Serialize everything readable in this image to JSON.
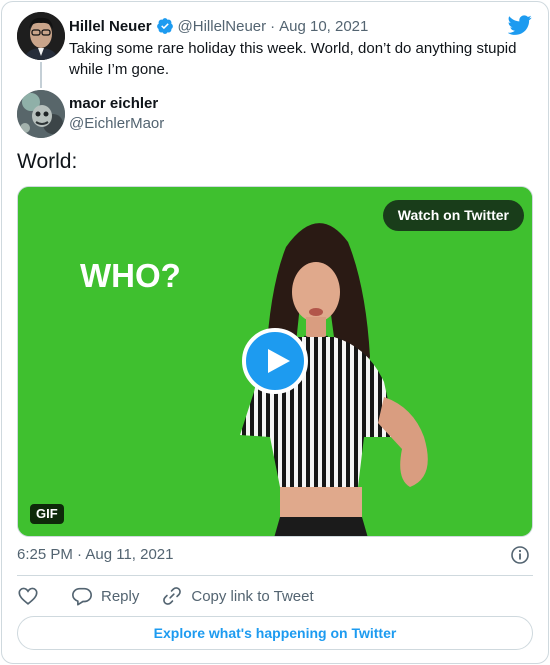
{
  "parent_tweet": {
    "author_name": "Hillel Neuer",
    "author_handle": "@HillelNeuer",
    "separator": "·",
    "date": "Aug 10, 2021",
    "text": "Taking some rare holiday this week. World, don’t do anything stupid while I’m gone."
  },
  "tweet": {
    "author_name": "maor eichler",
    "author_handle": "@EichlerMaor",
    "text": "World:",
    "timestamp": "6:25 PM · Aug 11, 2021"
  },
  "media": {
    "overlay_text": "WHO?",
    "watch_label": "Watch on Twitter",
    "badge": "GIF",
    "background_color": "#3fc02f"
  },
  "actions": {
    "like_icon": "heart-icon",
    "reply_label": "Reply",
    "copy_label": "Copy link to Tweet"
  },
  "explore_label": "Explore what's happening on Twitter",
  "colors": {
    "accent": "#1d9bf0",
    "muted_text": "#536471",
    "border": "#cfd9de"
  }
}
